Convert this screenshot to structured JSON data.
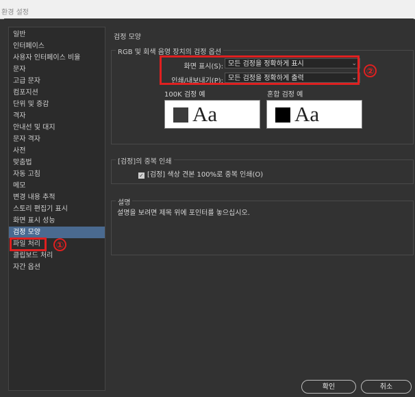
{
  "window": {
    "title": "환경 설정"
  },
  "sidebar": {
    "items": [
      {
        "label": "일반"
      },
      {
        "label": "인터페이스"
      },
      {
        "label": "사용자 인터페이스 비율"
      },
      {
        "label": "문자"
      },
      {
        "label": "고급 문자"
      },
      {
        "label": "컴포지션"
      },
      {
        "label": "단위 및 증감"
      },
      {
        "label": "격자"
      },
      {
        "label": "안내선 및 대지"
      },
      {
        "label": "문자 격자"
      },
      {
        "label": "사전"
      },
      {
        "label": "맞춤법"
      },
      {
        "label": "자동 고침"
      },
      {
        "label": "메모"
      },
      {
        "label": "변경 내용 추적"
      },
      {
        "label": "스토리 편집기 표시"
      },
      {
        "label": "화면 표시 성능"
      },
      {
        "label": "검정 모양",
        "selected": true
      },
      {
        "label": "파일 처리"
      },
      {
        "label": "클립보드 처리"
      },
      {
        "label": "자간 옵션"
      }
    ]
  },
  "main": {
    "section_title": "검정 모양",
    "rgb_group": {
      "legend": "RGB 및 회색 음영 장치의 검정 옵션",
      "screen_label": "화면 표시(S):",
      "screen_value": "모든 검정을 정확하게 표시",
      "print_label": "인쇄/내보내기(P):",
      "print_value": "모든 검정을 정확하게 출력",
      "k100_label": "100K 검정 예",
      "rich_label": "혼합 검정 예",
      "preview_text": "Aa"
    },
    "overprint_group": {
      "legend": "[검정]의 중복 인쇄",
      "checkbox_label": "[검정] 색상 견본 100%로 중복 인쇄(O)",
      "checked": true
    },
    "description_group": {
      "legend": "설명",
      "text": "설명을 보려면 제목 위에 포인터를 놓으십시오."
    }
  },
  "buttons": {
    "ok": "확인",
    "cancel": "취소"
  },
  "annotations": {
    "one": "①",
    "two": "②"
  },
  "colors": {
    "background": "#323232",
    "selected_item": "#4a6a90",
    "annotation_red": "#e02020",
    "k100_swatch": "#3c3c3c",
    "rich_swatch": "#000000"
  }
}
